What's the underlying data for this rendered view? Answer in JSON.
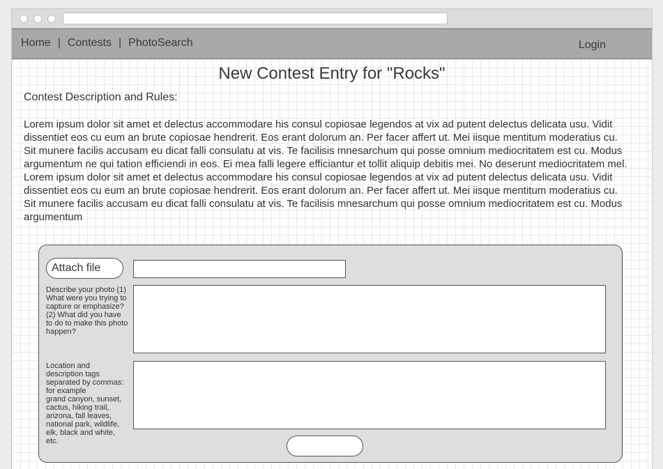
{
  "nav": {
    "home": "Home",
    "separator": "|",
    "contests": "Contests",
    "photosearch": "PhotoSearch",
    "login": "Login"
  },
  "page": {
    "title": "New Contest Entry for \"Rocks\"",
    "rules_heading": "Contest Description and Rules:",
    "description": "Lorem ipsum dolor sit amet et delectus accommodare his consul copiosae legendos at vix ad putent delectus delicata usu. Vidit dissentiet eos cu eum an brute copiosae hendrerit. Eos erant dolorum an. Per facer affert ut. Mei iisque mentitum moderatius cu. Sit munere facilis accusam eu dicat falli consulatu at vis. Te facilisis mnesarchum qui posse omnium mediocritatem est cu. Modus argumentum ne qui tation efficiendi in eos. Ei mea falli legere efficiantur et tollit aliquip debitis mei. No deserunt mediocritatem mel. Lorem ipsum dolor sit amet et delectus accommodare his consul copiosae legendos at vix ad putent delectus delicata usu. Vidit dissentiet eos cu eum an brute copiosae hendrerit. Eos erant dolorum an. Per facer affert ut. Mei iisque mentitum moderatius cu. Sit munere facilis accusam eu dicat falli consulatu at vis. Te facilisis mnesarchum qui posse omnium mediocritatem est cu. Modus argumentum"
  },
  "form": {
    "attach_label": "Attach file",
    "file_value": "",
    "describe_label": "Describe your photo (1) What were you trying to capture or emphasize? (2) What did you have to do to make this photo happen?",
    "describe_value": "",
    "tags_label": "Location and description tags separated by commas: for example\ngrand canyon, sunset, cactus, hiking trail, arizona, fall leaves, national park, wildlife, elk, black and white, etc.",
    "tags_value": "",
    "submit_label": ""
  }
}
